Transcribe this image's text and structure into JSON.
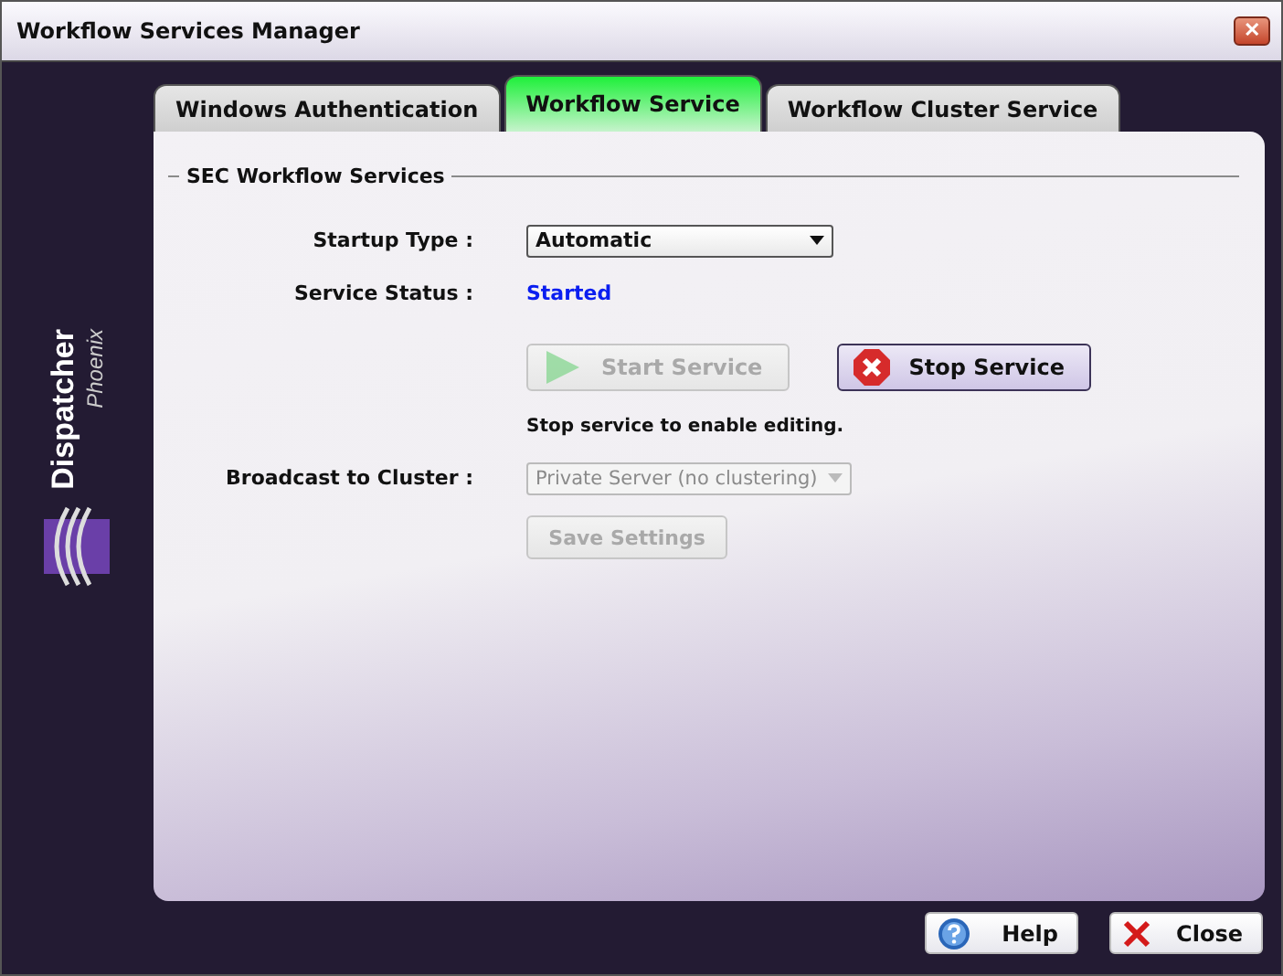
{
  "window": {
    "title": "Workflow Services Manager",
    "close_glyph": "✕"
  },
  "brand": {
    "name": "Dispatcher",
    "tagline": "Phoenix"
  },
  "tabs": [
    {
      "label": "Windows Authentication",
      "selected": false
    },
    {
      "label": "Workflow Service",
      "selected": true
    },
    {
      "label": "Workflow Cluster Service",
      "selected": false
    }
  ],
  "group": {
    "title": "SEC Workflow Services"
  },
  "startup_type": {
    "label": "Startup Type :",
    "value": "Automatic",
    "disabled": false
  },
  "service_status": {
    "label": "Service Status :",
    "value": "Started"
  },
  "service_buttons": [
    {
      "kind": "start",
      "label": "Start Service",
      "disabled": true
    },
    {
      "kind": "stop",
      "label": "Stop Service",
      "disabled": false
    }
  ],
  "hint": "Stop service to enable editing.",
  "broadcast": {
    "label": "Broadcast to Cluster :",
    "value": "Private Server (no clustering)",
    "disabled": true
  },
  "save_button": {
    "label": "Save Settings",
    "disabled": true
  },
  "footer_buttons": [
    {
      "kind": "help",
      "label": "Help"
    },
    {
      "kind": "close",
      "label": "Close"
    }
  ]
}
